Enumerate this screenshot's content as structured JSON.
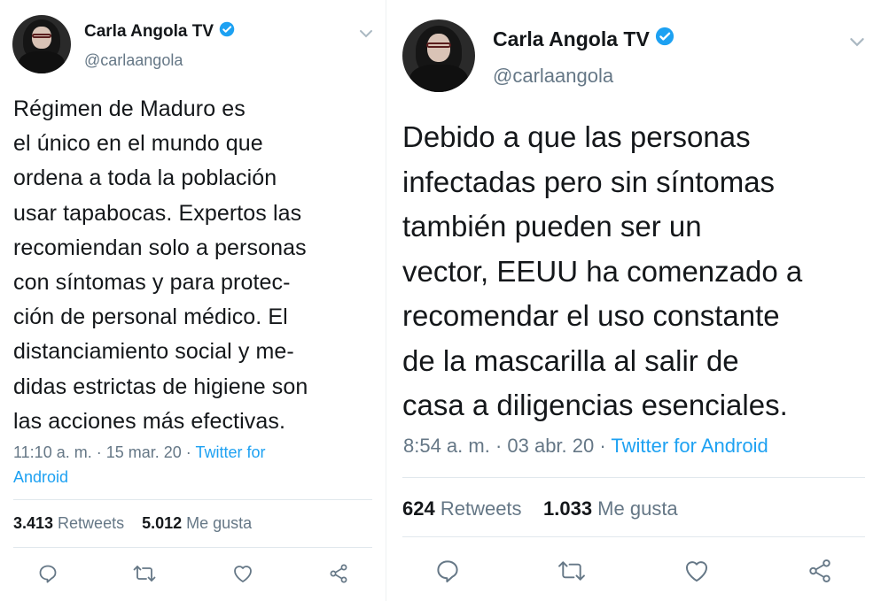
{
  "tweets": [
    {
      "author": {
        "name": "Carla Angola TV",
        "handle": "@carlaangola",
        "verified": true
      },
      "text": "Régimen de Maduro es\nel único en el mundo que\nordena a toda la población\nusar tapabocas. Expertos las\nrecomiendan solo a personas\ncon síntomas y para protec-\nción de personal médico. El\ndistanciamiento social y me-\ndidas estrictas de higiene son\nlas acciones más efectivas.",
      "time": "11:10 a. m. · 15 mar. 20 · ",
      "source": "Twitter for\nAndroid",
      "retweets_count": "3.413",
      "retweets_label": " Retweets",
      "likes_count": "5.012",
      "likes_label": " Me gusta"
    },
    {
      "author": {
        "name": "Carla Angola TV",
        "handle": "@carlaangola",
        "verified": true
      },
      "text": "Debido a que las personas\ninfectadas pero sin síntomas\ntambién pueden ser un\nvector, EEUU ha comenzado a\nrecomendar el uso constante\nde la mascarilla al salir de\ncasa a diligencias esenciales.",
      "time": "8:54 a. m. · 03 abr. 20 · ",
      "source": "Twitter for Android",
      "retweets_count": "624",
      "retweets_label": " Retweets",
      "likes_count": "1.033",
      "likes_label": " Me gusta"
    }
  ],
  "icons": [
    "chevron-down-icon",
    "verified-badge-icon",
    "reply-icon",
    "retweet-icon",
    "like-icon",
    "share-icon"
  ],
  "colors": {
    "text": "#14171a",
    "muted": "#657786",
    "link": "#1da1f2",
    "verified": "#1da1f2",
    "border": "#e1e8ed"
  }
}
